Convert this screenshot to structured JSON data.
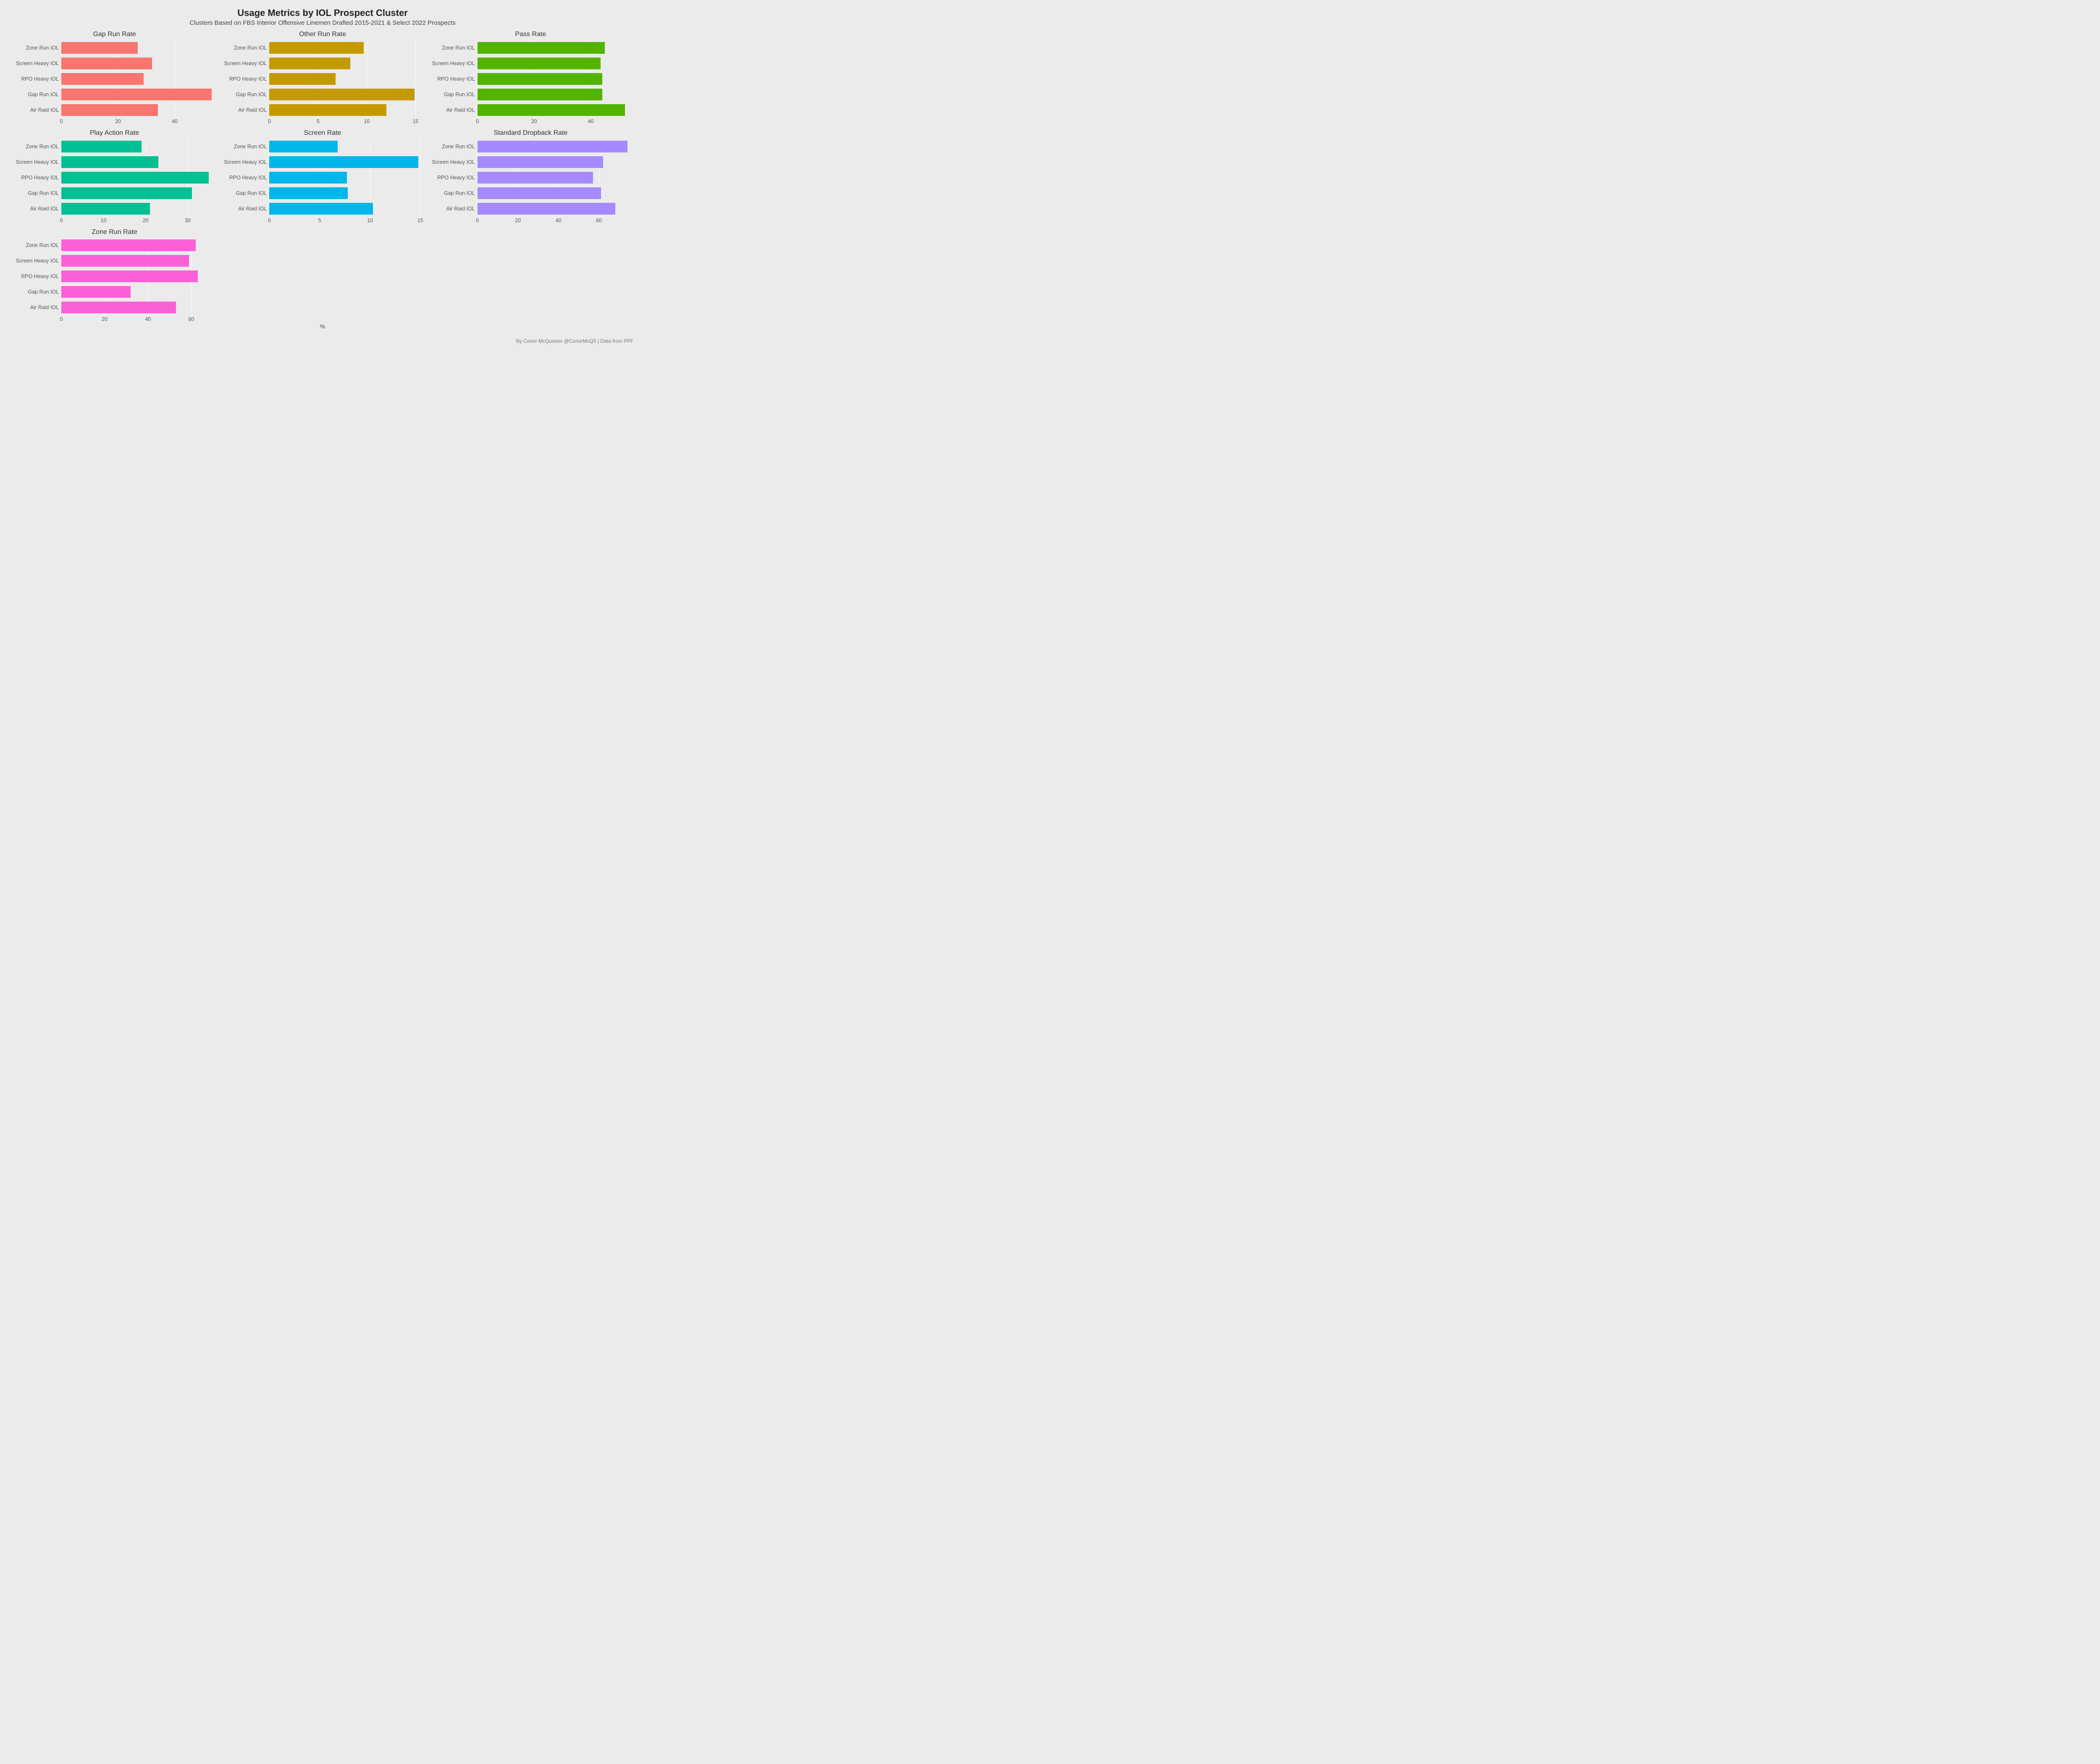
{
  "title": "Usage Metrics by IOL Prospect Cluster",
  "subtitle": "Clusters Based on FBS Interior Offensive Linemen Drafted 2015-2021 & Select 2022 Prospects",
  "xlabel": "%",
  "credit": "By Conor McQuiston @ConorMcQ5 | Data from PFF",
  "categories_top_to_bottom": [
    "Zone Run IOL",
    "Screen Heavy IOL",
    "RPO Heavy IOL",
    "Gap Run IOL",
    "Air Raid IOL"
  ],
  "colors": {
    "Gap Run Rate": "#F8766D",
    "Other Run Rate": "#C49A00",
    "Pass Rate": "#53B400",
    "Play Action Rate": "#00C094",
    "Screen Rate": "#00B6EB",
    "Standard Dropback Rate": "#A58AFF",
    "Zone Run Rate": "#FB61D7"
  },
  "chart_data": [
    {
      "name": "Gap Run Rate",
      "type": "bar",
      "xlim": [
        0,
        55
      ],
      "ticks": [
        0,
        20,
        40
      ],
      "values": {
        "Zone Run IOL": 27,
        "Screen Heavy IOL": 32,
        "RPO Heavy IOL": 29,
        "Gap Run IOL": 53,
        "Air Raid IOL": 34
      }
    },
    {
      "name": "Other Run Rate",
      "type": "bar",
      "xlim": [
        0,
        16
      ],
      "ticks": [
        0,
        5,
        10,
        15
      ],
      "values": {
        "Zone Run IOL": 9.7,
        "Screen Heavy IOL": 8.3,
        "RPO Heavy IOL": 6.8,
        "Gap Run IOL": 14.9,
        "Air Raid IOL": 12.0
      }
    },
    {
      "name": "Pass Rate",
      "type": "bar",
      "xlim": [
        0,
        55
      ],
      "ticks": [
        0,
        20,
        40
      ],
      "values": {
        "Zone Run IOL": 45,
        "Screen Heavy IOL": 43.5,
        "RPO Heavy IOL": 44,
        "Gap Run IOL": 44,
        "Air Raid IOL": 52
      }
    },
    {
      "name": "Play Action Rate",
      "type": "bar",
      "xlim": [
        0,
        37
      ],
      "ticks": [
        0,
        10,
        20,
        30
      ],
      "values": {
        "Zone Run IOL": 19,
        "Screen Heavy IOL": 23,
        "RPO Heavy IOL": 35,
        "Gap Run IOL": 31,
        "Air Raid IOL": 21
      }
    },
    {
      "name": "Screen Rate",
      "type": "bar",
      "xlim": [
        0,
        15.5
      ],
      "ticks": [
        0,
        5,
        10,
        15
      ],
      "values": {
        "Zone Run IOL": 6.8,
        "Screen Heavy IOL": 14.8,
        "RPO Heavy IOL": 7.7,
        "Gap Run IOL": 7.8,
        "Air Raid IOL": 10.3
      }
    },
    {
      "name": "Standard Dropback Rate",
      "type": "bar",
      "xlim": [
        0,
        77
      ],
      "ticks": [
        0,
        20,
        40,
        60
      ],
      "values": {
        "Zone Run IOL": 74,
        "Screen Heavy IOL": 62,
        "RPO Heavy IOL": 57,
        "Gap Run IOL": 61,
        "Air Raid IOL": 68
      }
    },
    {
      "name": "Zone Run Rate",
      "type": "bar",
      "xlim": [
        0,
        72
      ],
      "ticks": [
        0,
        20,
        40,
        60
      ],
      "values": {
        "Zone Run IOL": 62,
        "Screen Heavy IOL": 59,
        "RPO Heavy IOL": 63,
        "Gap Run IOL": 32,
        "Air Raid IOL": 53
      }
    }
  ]
}
